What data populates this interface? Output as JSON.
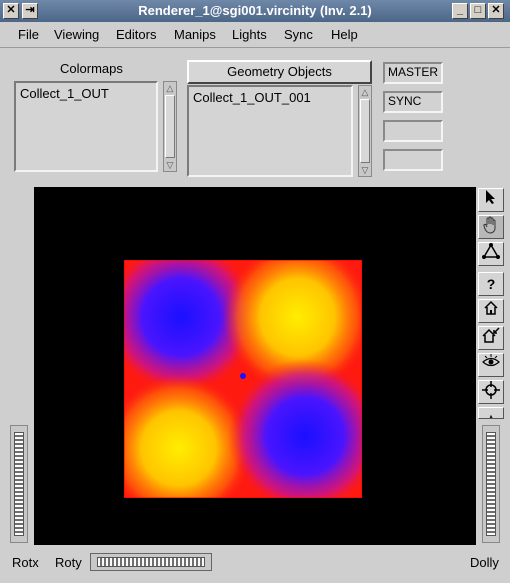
{
  "window": {
    "title": "Renderer_1@sgi001.vircinity (Inv. 2.1)"
  },
  "menu": [
    "File",
    "Viewing",
    "Editors",
    "Manips",
    "Lights",
    "Sync",
    "Help"
  ],
  "colormaps": {
    "label": "Colormaps",
    "items": [
      "Collect_1_OUT"
    ]
  },
  "geometry": {
    "label": "Geometry Objects",
    "items": [
      "Collect_1_OUT_001"
    ]
  },
  "side_buttons": {
    "master": "MASTER",
    "sync": "SYNC",
    "empty1": "",
    "empty2": ""
  },
  "toolbar": {
    "pick": "pick-arrow-icon",
    "view": "hand-icon",
    "seek": "seek-icon",
    "help": "?",
    "home": "home-icon",
    "set_home": "set-home-icon",
    "view_all": "view-all-eye-icon",
    "seek_point": "crosshair-icon",
    "perspective": "perspective-icon"
  },
  "bottom": {
    "rotx": "Rotx",
    "roty": "Roty",
    "dolly": "Dolly"
  },
  "colors": {
    "viewer_bg": "#000000",
    "red": "#ff1a10",
    "yellow": "#ffee00",
    "blue": "#1a10ff"
  }
}
